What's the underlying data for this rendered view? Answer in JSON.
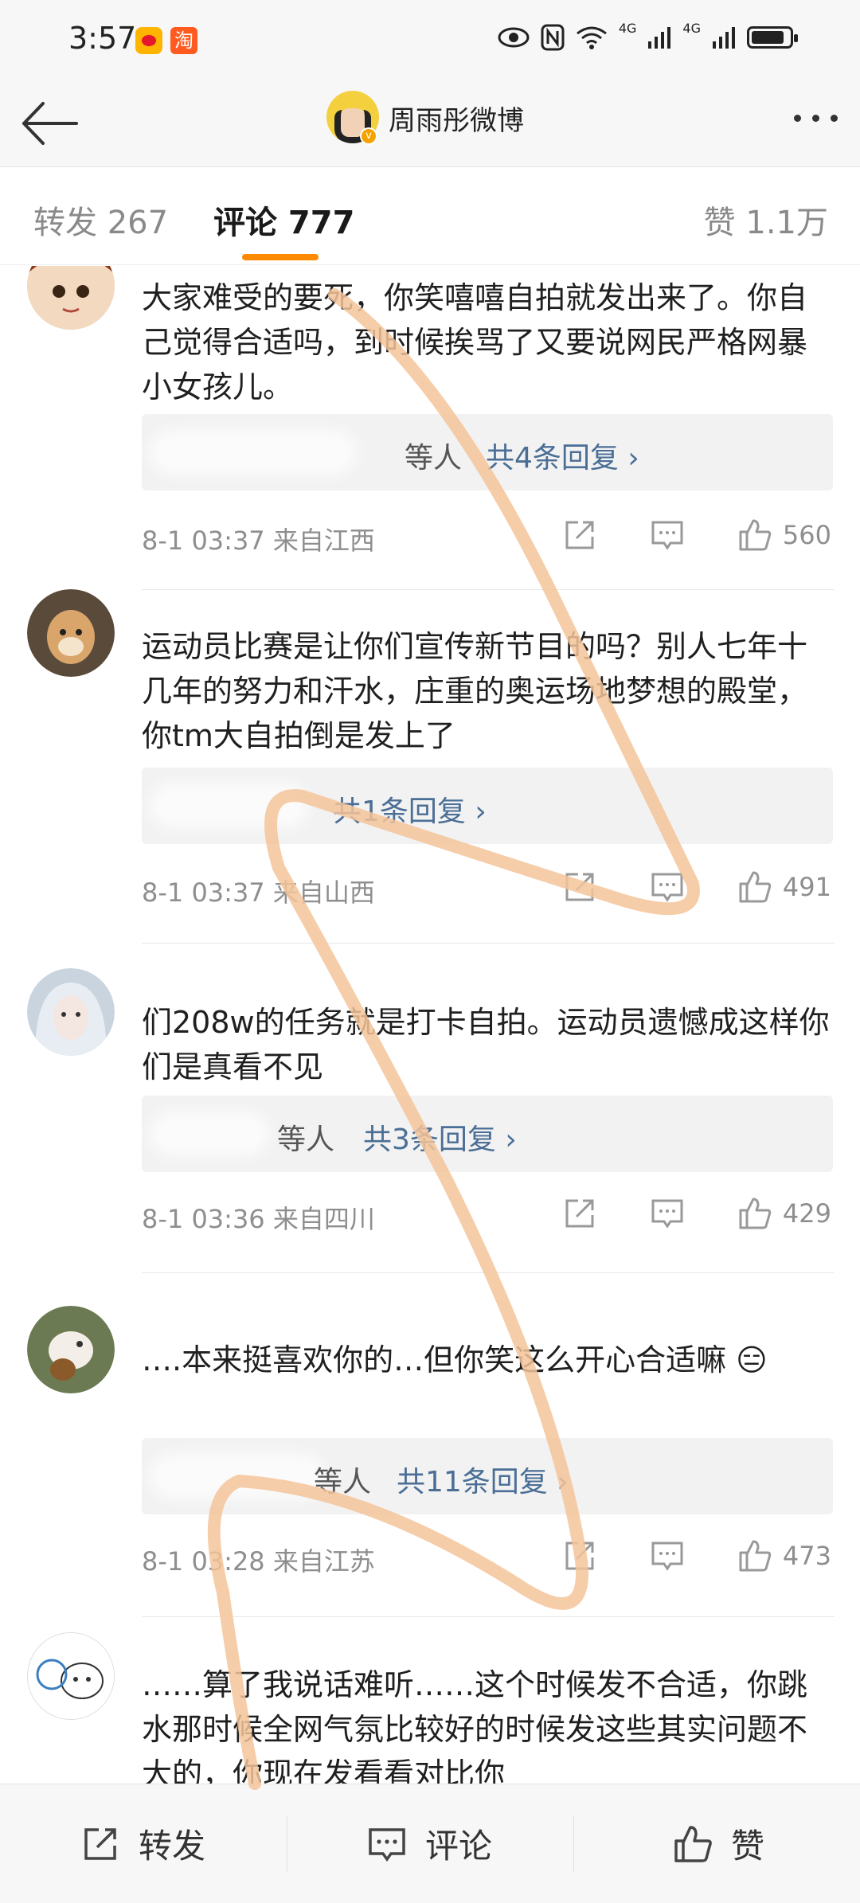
{
  "status_bar": {
    "time": "3:57",
    "app_badge_2": "淘",
    "network_1": "4G",
    "network_2": "4G"
  },
  "header": {
    "title": "周雨彤微博",
    "verified_badge": "v"
  },
  "tabs": {
    "repost": "转发 267",
    "comment": "评论 777",
    "likes": "赞 1.1万"
  },
  "comments": [
    {
      "name": "",
      "text": "大家难受的要死，你笑嘻嘻自拍就发出来了。你自己觉得合适吗，到时候挨骂了又要说网民严格网暴小女孩儿。",
      "replies_who": "等人",
      "replies_count": "共4条回复 ›",
      "time": "8-1 03:37",
      "location": "来自江西",
      "likes": "560"
    },
    {
      "name": "",
      "text": "运动员比赛是让你们宣传新节目的吗？别人七年十几年的努力和汗水，庄重的奥运场地梦想的殿堂，你tm大自拍倒是发上了",
      "replies_who": "",
      "replies_count": "共1条回复 ›",
      "time": "8-1 03:37",
      "location": "来自山西",
      "likes": "491"
    },
    {
      "name": "",
      "text": "们208w的任务就是打卡自拍。运动员遗憾成这样你们是真看不见",
      "replies_who": "等人",
      "replies_count": "共3条回复 ›",
      "time": "8-1 03:36",
      "location": "来自四川",
      "likes": "429"
    },
    {
      "name": "",
      "text": "….本来挺喜欢你的…但你笑这么开心合适嘛 😑",
      "replies_who": "等人",
      "replies_count": "共11条回复 ›",
      "time": "8-1 03:28",
      "location": "来自江苏",
      "likes": "473"
    },
    {
      "name": "",
      "text": "……算了我说话难听……这个时候发不合适，你跳水那时候全网气氛比较好的时候发这些其实问题不大的，你现在发看看对比你"
    }
  ],
  "bottom_bar": {
    "repost": "转发",
    "comment": "评论",
    "like": "赞"
  },
  "colors": {
    "accent_underline": "#ff8a00",
    "reply_link": "#4a6e95",
    "scribble": "#f5c49a"
  }
}
